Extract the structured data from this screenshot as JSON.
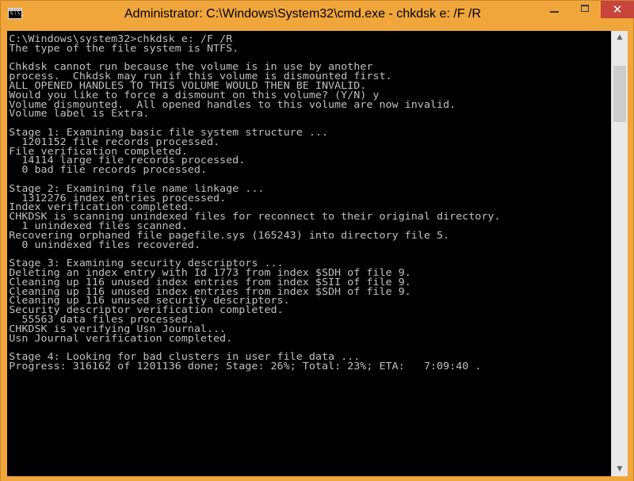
{
  "window": {
    "title": "Administrator: C:\\Windows\\System32\\cmd.exe - chkdsk  e: /F /R",
    "icon": "cmd-icon",
    "icon_glyph": "C:\\_",
    "controls": {
      "close_label": "✕"
    },
    "accent": "#f0a63b",
    "close_color": "#c7453a"
  },
  "console": {
    "background": "#000000",
    "foreground": "#c0c0c0",
    "lines": [
      "C:\\Windows\\system32>chkdsk e: /F /R",
      "The type of the file system is NTFS.",
      "",
      "Chkdsk cannot run because the volume is in use by another",
      "process.  Chkdsk may run if this volume is dismounted first.",
      "ALL OPENED HANDLES TO THIS VOLUME WOULD THEN BE INVALID.",
      "Would you like to force a dismount on this volume? (Y/N) y",
      "Volume dismounted.  All opened handles to this volume are now invalid.",
      "Volume label is Extra.",
      "",
      "Stage 1: Examining basic file system structure ...",
      "  1201152 file records processed.",
      "File verification completed.",
      "  14114 large file records processed.",
      "  0 bad file records processed.",
      "",
      "Stage 2: Examining file name linkage ...",
      "  1312276 index entries processed.",
      "Index verification completed.",
      "CHKDSK is scanning unindexed files for reconnect to their original directory.",
      "  1 unindexed files scanned.",
      "Recovering orphaned file pagefile.sys (165243) into directory file 5.",
      "  0 unindexed files recovered.",
      "",
      "Stage 3: Examining security descriptors ...",
      "Deleting an index entry with Id 1773 from index $SDH of file 9.",
      "Cleaning up 116 unused index entries from index $SII of file 9.",
      "Cleaning up 116 unused index entries from index $SDH of file 9.",
      "Cleaning up 116 unused security descriptors.",
      "Security descriptor verification completed.",
      "  55563 data files processed.",
      "CHKDSK is verifying Usn Journal...",
      "Usn Journal verification completed.",
      "",
      "Stage 4: Looking for bad clusters in user file data ...",
      "Progress: 316162 of 1201136 done; Stage: 26%; Total: 23%; ETA:   7:09:40 ."
    ]
  },
  "scrollbar": {
    "up_arrow": "▲",
    "down_arrow": "▼"
  }
}
